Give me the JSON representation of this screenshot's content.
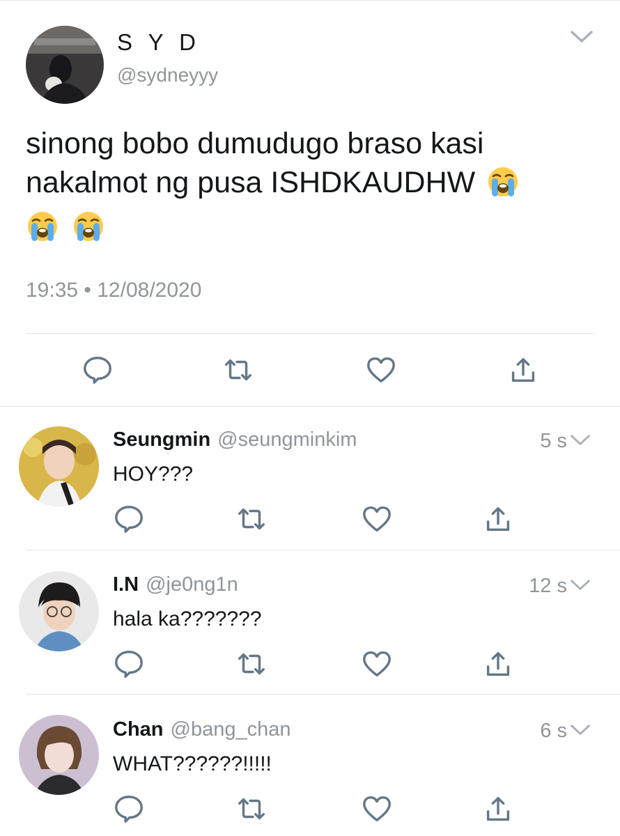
{
  "main_tweet": {
    "display_name": "S Y D",
    "handle": "@sydneyyy",
    "text": "sinong bobo dumudugo braso kasi nakalmot ng pusa ISHDKAUDHW",
    "timestamp": "19:35 • 12/08/2020",
    "emoji": "loudly-crying-face",
    "icons": [
      "chevron-down-icon",
      "reply-icon",
      "retweet-icon",
      "like-icon",
      "share-icon"
    ]
  },
  "replies": [
    {
      "name": "Seungmin",
      "handle": "@seungminkim",
      "time": "5 s",
      "text": "HOY???"
    },
    {
      "name": "I.N",
      "handle": "@je0ng1n",
      "time": "12 s",
      "text": "hala ka???????"
    },
    {
      "name": "Chan",
      "handle": "@bang_chan",
      "time": "6 s",
      "text": "WHAT??????!!!!!"
    }
  ],
  "colors": {
    "text": "#14171a",
    "secondary": "#8f959b",
    "icon": "#657786",
    "divider": "#e1e6ea"
  }
}
